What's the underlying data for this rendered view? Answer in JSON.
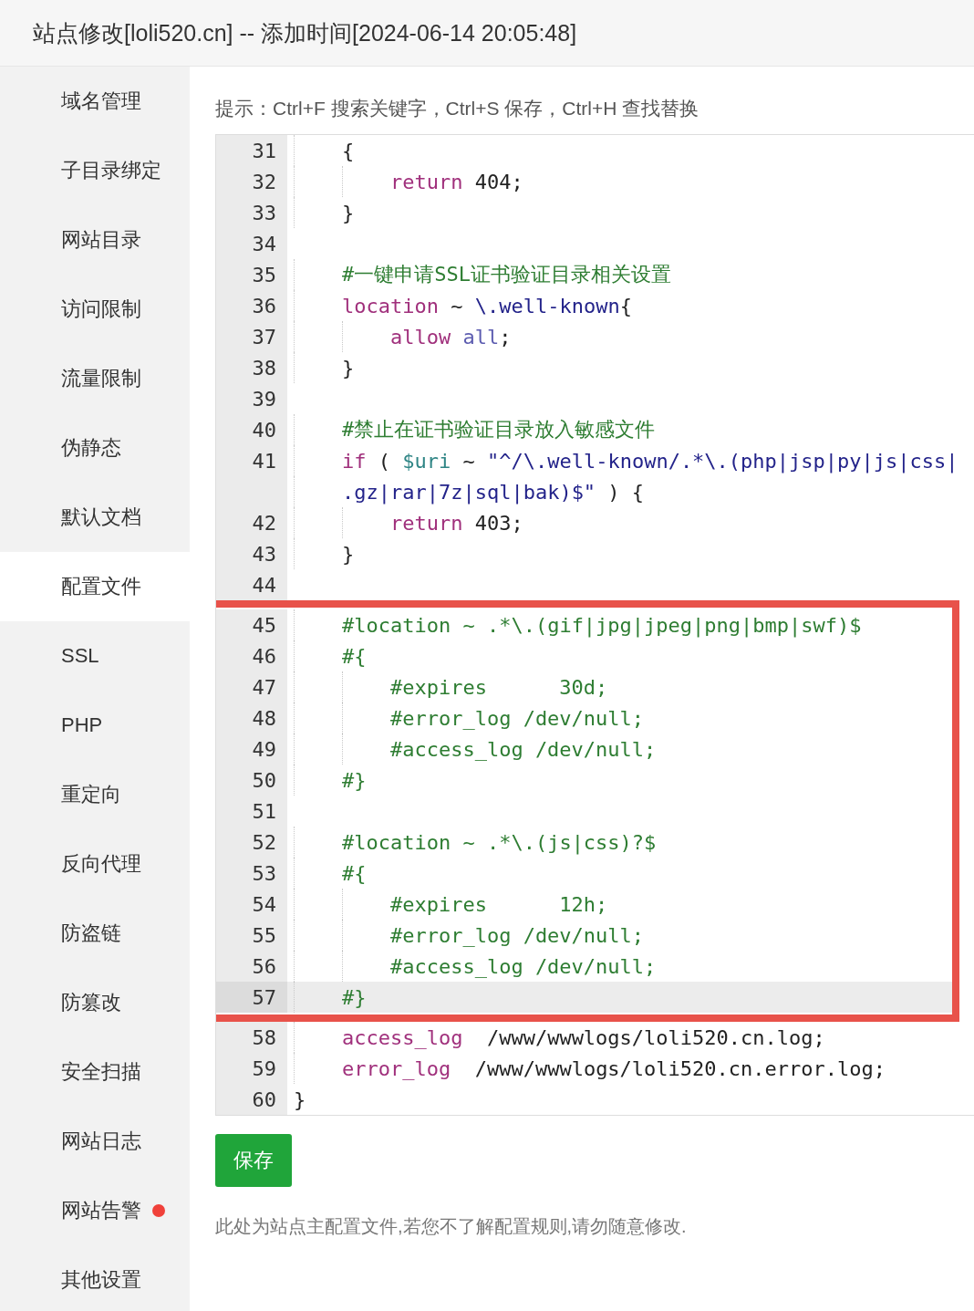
{
  "window": {
    "title": "站点修改[loli520.cn] -- 添加时间[2024-06-14 20:05:48]"
  },
  "sidebar": {
    "items": [
      {
        "label": "域名管理",
        "selected": false,
        "alert": false
      },
      {
        "label": "子目录绑定",
        "selected": false,
        "alert": false
      },
      {
        "label": "网站目录",
        "selected": false,
        "alert": false
      },
      {
        "label": "访问限制",
        "selected": false,
        "alert": false
      },
      {
        "label": "流量限制",
        "selected": false,
        "alert": false
      },
      {
        "label": "伪静态",
        "selected": false,
        "alert": false
      },
      {
        "label": "默认文档",
        "selected": false,
        "alert": false
      },
      {
        "label": "配置文件",
        "selected": true,
        "alert": false
      },
      {
        "label": "SSL",
        "selected": false,
        "alert": false
      },
      {
        "label": "PHP",
        "selected": false,
        "alert": false
      },
      {
        "label": "重定向",
        "selected": false,
        "alert": false
      },
      {
        "label": "反向代理",
        "selected": false,
        "alert": false
      },
      {
        "label": "防盗链",
        "selected": false,
        "alert": false
      },
      {
        "label": "防篡改",
        "selected": false,
        "alert": false
      },
      {
        "label": "安全扫描",
        "selected": false,
        "alert": false
      },
      {
        "label": "网站日志",
        "selected": false,
        "alert": false
      },
      {
        "label": "网站告警",
        "selected": false,
        "alert": true
      },
      {
        "label": "其他设置",
        "selected": false,
        "alert": false
      }
    ]
  },
  "hint": "提示：Ctrl+F 搜索关键字，Ctrl+S 保存，Ctrl+H 查找替换",
  "editor": {
    "sections": [
      {
        "boxed": false,
        "lines": [
          {
            "number": "31",
            "active": false,
            "tokens": [
              {
                "kind": "plain",
                "text": "    {"
              }
            ]
          },
          {
            "number": "32",
            "active": false,
            "tokens": [
              {
                "kind": "keyword",
                "text": "        return"
              },
              {
                "kind": "plain",
                "text": " 404;"
              }
            ]
          },
          {
            "number": "33",
            "active": false,
            "tokens": [
              {
                "kind": "plain",
                "text": "    }"
              }
            ]
          },
          {
            "number": "34",
            "active": false
          },
          {
            "number": "35",
            "active": false,
            "tokens": [
              {
                "kind": "comment",
                "text": "    #一键申请SSL证书验证目录相关设置"
              }
            ]
          },
          {
            "number": "36",
            "active": false,
            "tokens": [
              {
                "kind": "keyword",
                "text": "    location"
              },
              {
                "kind": "plain",
                "text": " ~ "
              },
              {
                "kind": "string",
                "text": "\\.well-known"
              },
              {
                "kind": "plain",
                "text": "{"
              }
            ]
          },
          {
            "number": "37",
            "active": false,
            "tokens": [
              {
                "kind": "keyword",
                "text": "        allow"
              },
              {
                "kind": "atom",
                "text": " all"
              },
              {
                "kind": "plain",
                "text": ";"
              }
            ]
          },
          {
            "number": "38",
            "active": false,
            "tokens": [
              {
                "kind": "plain",
                "text": "    }"
              }
            ]
          },
          {
            "number": "39",
            "active": false
          },
          {
            "number": "40",
            "active": false,
            "tokens": [
              {
                "kind": "comment",
                "text": "    #禁止在证书验证目录放入敏感文件"
              }
            ]
          },
          {
            "number": "41",
            "active": false,
            "tokens": [
              {
                "kind": "keyword",
                "text": "    if"
              },
              {
                "kind": "plain",
                "text": " ( "
              },
              {
                "kind": "variable",
                "text": "$uri"
              },
              {
                "kind": "plain",
                "text": " ~ "
              },
              {
                "kind": "string",
                "text": "\"^/\\.well-known/.*\\.(php|jsp|py|js|css|"
              }
            ]
          },
          {
            "active": false,
            "tokens": [
              {
                "kind": "string",
                "text": "      .gz|rar|7z|sql|bak)$\""
              },
              {
                "kind": "plain",
                "text": " ) {"
              }
            ]
          },
          {
            "number": "42",
            "active": false,
            "tokens": [
              {
                "kind": "keyword",
                "text": "        return"
              },
              {
                "kind": "plain",
                "text": " 403;"
              }
            ]
          },
          {
            "number": "43",
            "active": false,
            "tokens": [
              {
                "kind": "plain",
                "text": "    }"
              }
            ]
          },
          {
            "number": "44",
            "active": false
          }
        ]
      },
      {
        "boxed": true,
        "lines": [
          {
            "number": "45",
            "active": false,
            "tokens": [
              {
                "kind": "comment",
                "text": "    #location ~ .*\\.(gif|jpg|jpeg|png|bmp|swf)$"
              }
            ]
          },
          {
            "number": "46",
            "active": false,
            "tokens": [
              {
                "kind": "comment",
                "text": "    #{"
              }
            ]
          },
          {
            "number": "47",
            "active": false,
            "tokens": [
              {
                "kind": "comment",
                "text": "        #expires      30d;"
              }
            ]
          },
          {
            "number": "48",
            "active": false,
            "tokens": [
              {
                "kind": "comment",
                "text": "        #error_log /dev/null;"
              }
            ]
          },
          {
            "number": "49",
            "active": false,
            "tokens": [
              {
                "kind": "comment",
                "text": "        #access_log /dev/null;"
              }
            ]
          },
          {
            "number": "50",
            "active": false,
            "tokens": [
              {
                "kind": "comment",
                "text": "    #}"
              }
            ]
          },
          {
            "number": "51",
            "active": false
          },
          {
            "number": "52",
            "active": false,
            "tokens": [
              {
                "kind": "comment",
                "text": "    #location ~ .*\\.(js|css)?$"
              }
            ]
          },
          {
            "number": "53",
            "active": false,
            "tokens": [
              {
                "kind": "comment",
                "text": "    #{"
              }
            ]
          },
          {
            "number": "54",
            "active": false,
            "tokens": [
              {
                "kind": "comment",
                "text": "        #expires      12h;"
              }
            ]
          },
          {
            "number": "55",
            "active": false,
            "tokens": [
              {
                "kind": "comment",
                "text": "        #error_log /dev/null;"
              }
            ]
          },
          {
            "number": "56",
            "active": false,
            "tokens": [
              {
                "kind": "comment",
                "text": "        #access_log /dev/null;"
              }
            ]
          },
          {
            "number": "57",
            "active": true,
            "tokens": [
              {
                "kind": "comment",
                "text": "    #}"
              }
            ]
          }
        ]
      },
      {
        "boxed": false,
        "lines": [
          {
            "number": "58",
            "active": false,
            "tokens": [
              {
                "kind": "keyword",
                "text": "    access_log"
              },
              {
                "kind": "plain",
                "text": "  /www/wwwlogs/loli520.cn.log;"
              }
            ]
          },
          {
            "number": "59",
            "active": false,
            "tokens": [
              {
                "kind": "keyword",
                "text": "    error_log"
              },
              {
                "kind": "plain",
                "text": "  /www/wwwlogs/loli520.cn.error.log;"
              }
            ]
          },
          {
            "number": "60",
            "active": false,
            "tokens": [
              {
                "kind": "plain",
                "text": "}"
              }
            ]
          }
        ]
      }
    ]
  },
  "save_button": "保存",
  "note": "此处为站点主配置文件,若您不了解配置规则,请勿随意修改."
}
